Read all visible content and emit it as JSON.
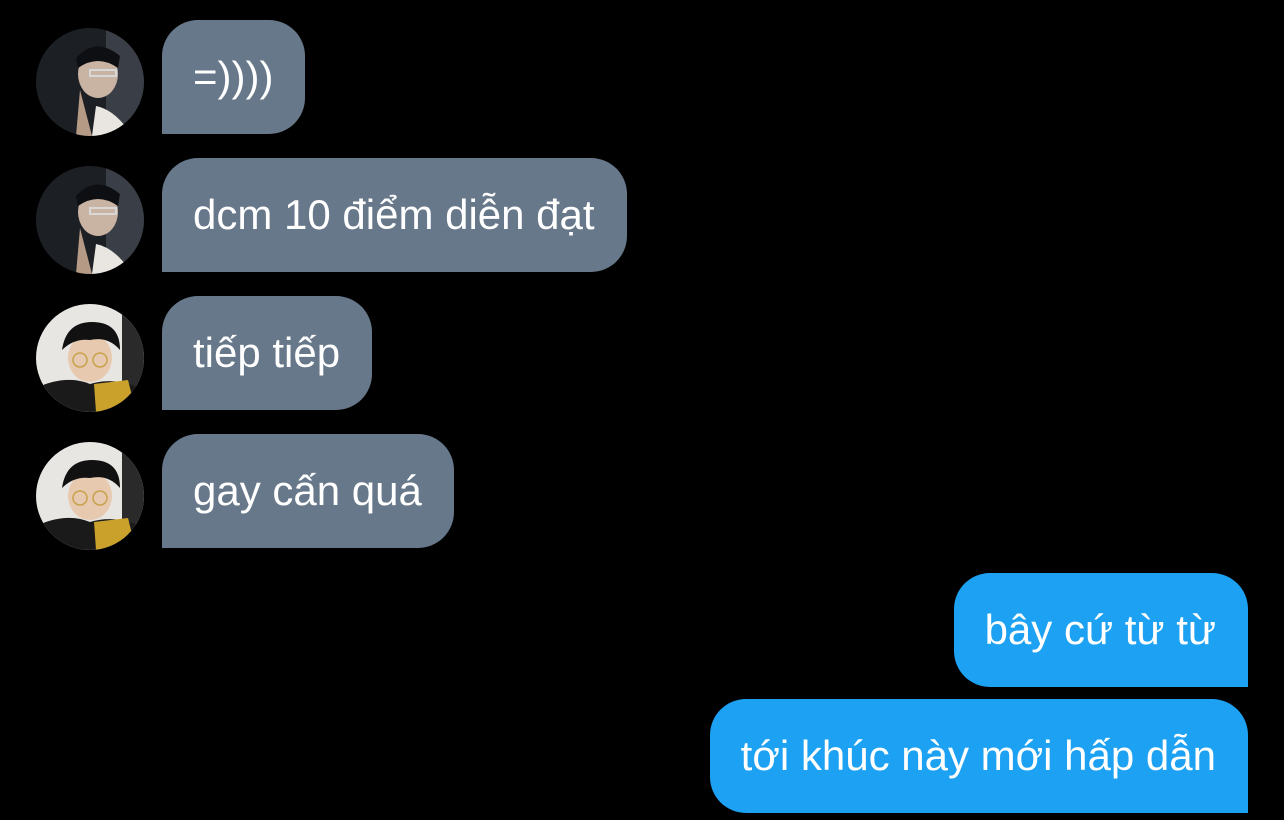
{
  "colors": {
    "background": "#000000",
    "incoming_bubble": "#67788a",
    "outgoing_bubble": "#1da1f2",
    "text": "#ffffff"
  },
  "messages": [
    {
      "direction": "incoming",
      "sender_avatar": "avatar-a",
      "text": "=))))"
    },
    {
      "direction": "incoming",
      "sender_avatar": "avatar-a",
      "text": "dcm 10 điểm diễn đạt"
    },
    {
      "direction": "incoming",
      "sender_avatar": "avatar-b",
      "text": "tiếp tiếp"
    },
    {
      "direction": "incoming",
      "sender_avatar": "avatar-b",
      "text": "gay cấn quá"
    },
    {
      "direction": "outgoing",
      "text": "bây cứ từ từ"
    },
    {
      "direction": "outgoing",
      "text": "tới khúc này mới hấp dẫn"
    }
  ]
}
